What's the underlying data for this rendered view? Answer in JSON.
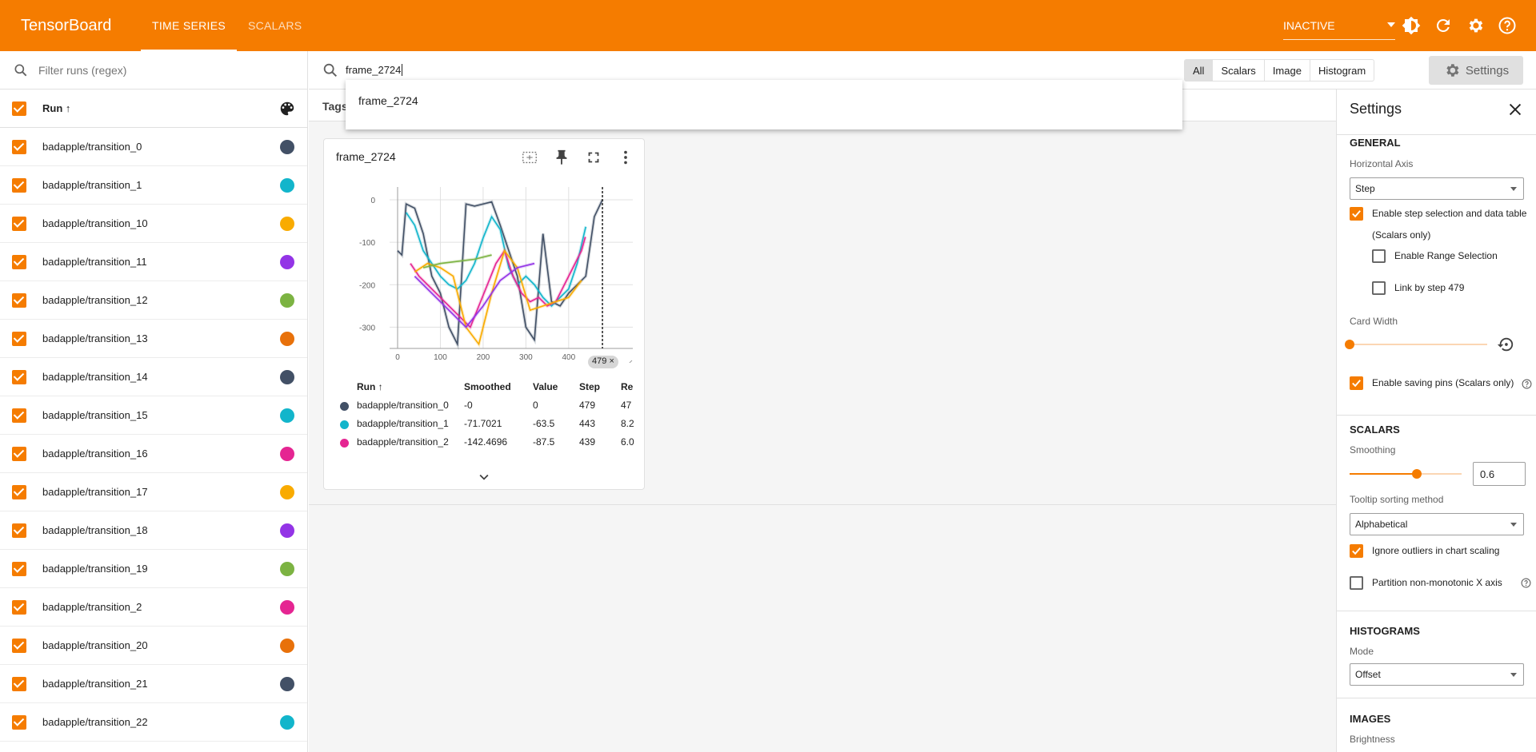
{
  "app": {
    "brand": "TensorBoard",
    "tabs": [
      "TIME SERIES",
      "SCALARS"
    ],
    "status": "INACTIVE"
  },
  "sidebar": {
    "filter_placeholder": "Filter runs (regex)",
    "run_header": "Run ↑",
    "runs": [
      {
        "name": "badapple/transition_0",
        "color": "#425066"
      },
      {
        "name": "badapple/transition_1",
        "color": "#12b5cb"
      },
      {
        "name": "badapple/transition_10",
        "color": "#f9ab00"
      },
      {
        "name": "badapple/transition_11",
        "color": "#9334e6"
      },
      {
        "name": "badapple/transition_12",
        "color": "#7cb342"
      },
      {
        "name": "badapple/transition_13",
        "color": "#e8710a"
      },
      {
        "name": "badapple/transition_14",
        "color": "#425066"
      },
      {
        "name": "badapple/transition_15",
        "color": "#12b5cb"
      },
      {
        "name": "badapple/transition_16",
        "color": "#e52592"
      },
      {
        "name": "badapple/transition_17",
        "color": "#f9ab00"
      },
      {
        "name": "badapple/transition_18",
        "color": "#9334e6"
      },
      {
        "name": "badapple/transition_19",
        "color": "#7cb342"
      },
      {
        "name": "badapple/transition_2",
        "color": "#e52592"
      },
      {
        "name": "badapple/transition_20",
        "color": "#e8710a"
      },
      {
        "name": "badapple/transition_21",
        "color": "#425066"
      },
      {
        "name": "badapple/transition_22",
        "color": "#12b5cb"
      }
    ]
  },
  "search": {
    "value": "frame_2724",
    "suggestion": "frame_2724",
    "filters": [
      "All",
      "Scalars",
      "Image",
      "Histogram"
    ],
    "settings_label": "Settings"
  },
  "tags_label": "Tags",
  "card": {
    "title": "frame_2724",
    "step_marker": "479 ×",
    "table_headers": [
      "Run ↑",
      "Smoothed",
      "Value",
      "Step",
      "Re"
    ],
    "table_rows": [
      {
        "run": "badapple/transition_0",
        "smoothed": "-0",
        "value": "0",
        "step": "479",
        "rel": "47",
        "color": "#425066"
      },
      {
        "run": "badapple/transition_1",
        "smoothed": "-71.7021",
        "value": "-63.5",
        "step": "443",
        "rel": "8.2",
        "color": "#12b5cb"
      },
      {
        "run": "badapple/transition_2",
        "smoothed": "-142.4696",
        "value": "-87.5",
        "step": "439",
        "rel": "6.0",
        "color": "#e52592"
      }
    ]
  },
  "chart_data": {
    "type": "line",
    "x_ticks": [
      "0",
      "100",
      "200",
      "300",
      "400"
    ],
    "y_ticks": [
      "0",
      "-100",
      "-200",
      "-300"
    ],
    "xlim": [
      0,
      550
    ],
    "ylim": [
      -350,
      30
    ],
    "selected_step": 479,
    "series": [
      {
        "color": "#425066",
        "x": [
          0,
          10,
          20,
          40,
          60,
          80,
          100,
          120,
          140,
          160,
          180,
          200,
          220,
          240,
          260,
          280,
          300,
          320,
          340,
          360,
          380,
          400,
          420,
          440,
          460,
          479
        ],
        "y": [
          -120,
          -130,
          -10,
          -20,
          -80,
          -180,
          -220,
          -300,
          -340,
          -10,
          -15,
          -10,
          -5,
          -60,
          -120,
          -180,
          -300,
          -330,
          -80,
          -240,
          -250,
          -220,
          -200,
          -180,
          -40,
          0
        ]
      },
      {
        "color": "#12b5cb",
        "x": [
          20,
          40,
          60,
          80,
          100,
          120,
          140,
          160,
          180,
          200,
          220,
          240,
          260,
          280,
          300,
          320,
          340,
          360,
          380,
          400,
          420,
          440
        ],
        "y": [
          -30,
          -60,
          -120,
          -150,
          -180,
          -200,
          -210,
          -190,
          -150,
          -90,
          -40,
          -70,
          -160,
          -200,
          -180,
          -200,
          -230,
          -250,
          -230,
          -210,
          -150,
          -63.5
        ]
      },
      {
        "color": "#e52592",
        "x": [
          30,
          50,
          70,
          90,
          110,
          130,
          150,
          170,
          190,
          210,
          230,
          250,
          270,
          290,
          310,
          330,
          350,
          370,
          390,
          410,
          430,
          439
        ],
        "y": [
          -150,
          -180,
          -200,
          -220,
          -240,
          -260,
          -280,
          -300,
          -250,
          -200,
          -150,
          -120,
          -180,
          -220,
          -240,
          -230,
          -250,
          -240,
          -200,
          -160,
          -120,
          -87.5
        ]
      },
      {
        "color": "#f9ab00",
        "x": [
          40,
          70,
          100,
          130,
          160,
          190,
          220,
          250,
          280,
          310,
          340,
          370,
          400,
          430
        ],
        "y": [
          -170,
          -150,
          -160,
          -180,
          -300,
          -340,
          -220,
          -120,
          -160,
          -260,
          -250,
          -240,
          -230,
          -190
        ]
      },
      {
        "color": "#9334e6",
        "x": [
          40,
          80,
          120,
          160,
          200,
          240,
          280,
          320
        ],
        "y": [
          -180,
          -220,
          -260,
          -300,
          -250,
          -190,
          -160,
          -150
        ]
      },
      {
        "color": "#7cb342",
        "x": [
          60,
          100,
          140,
          180,
          220
        ],
        "y": [
          -160,
          -150,
          -145,
          -140,
          -130
        ]
      }
    ]
  },
  "settings": {
    "title": "Settings",
    "general": "GENERAL",
    "horizontal_axis_label": "Horizontal Axis",
    "horizontal_axis_value": "Step",
    "enable_step_selection": "Enable step selection and data table",
    "scalars_only": "(Scalars only)",
    "enable_range_selection": "Enable Range Selection",
    "link_by_step": "Link by step 479",
    "card_width": "Card Width",
    "enable_saving_pins": "Enable saving pins (Scalars only)",
    "scalars": "SCALARS",
    "smoothing_label": "Smoothing",
    "smoothing_value": "0.6",
    "smoothing_fraction": 0.6,
    "tooltip_sorting_label": "Tooltip sorting method",
    "tooltip_sorting_value": "Alphabetical",
    "ignore_outliers": "Ignore outliers in chart scaling",
    "partition_label": "Partition non-monotonic X axis",
    "histograms": "HISTOGRAMS",
    "mode_label": "Mode",
    "mode_value": "Offset",
    "images": "IMAGES",
    "brightness": "Brightness"
  }
}
